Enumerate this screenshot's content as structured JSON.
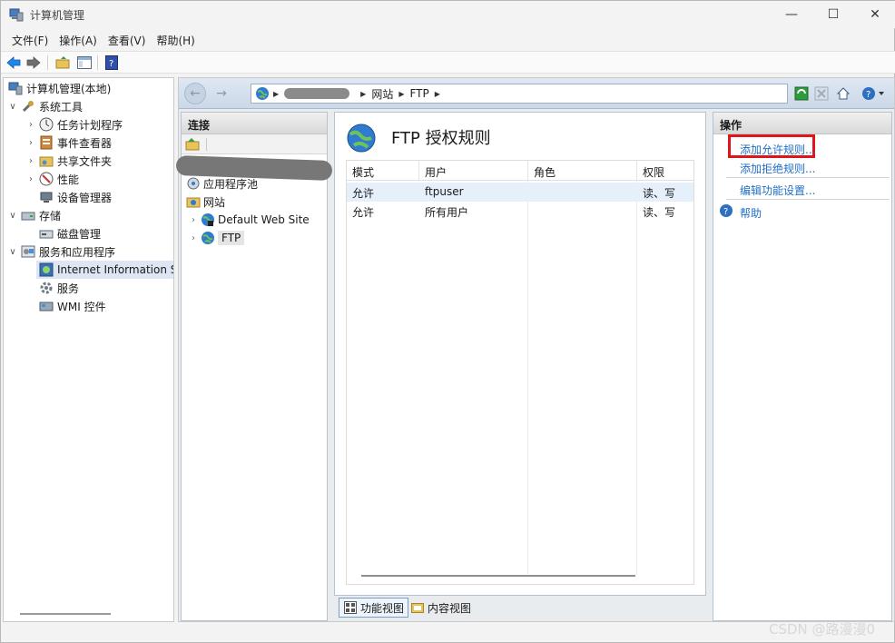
{
  "window": {
    "title": "计算机管理"
  },
  "menu": [
    "文件(F)",
    "操作(A)",
    "查看(V)",
    "帮助(H)"
  ],
  "tree": {
    "root": "计算机管理(本地)",
    "system_tools": "系统工具",
    "task_scheduler": "任务计划程序",
    "event_viewer": "事件查看器",
    "shared_folders": "共享文件夹",
    "performance": "性能",
    "device_manager": "设备管理器",
    "storage": "存储",
    "disk_management": "磁盘管理",
    "services_apps": "服务和应用程序",
    "iis": "Internet Information S",
    "services": "服务",
    "wmi": "WMI 控件"
  },
  "address": {
    "crumbs": [
      "网站",
      "FTP"
    ]
  },
  "connections": {
    "header": "连接",
    "app_pools": "应用程序池",
    "sites": "网站",
    "default_site": "Default Web Site",
    "ftp": "FTP"
  },
  "center": {
    "title": "FTP 授权规则",
    "columns": [
      "模式",
      "用户",
      "角色",
      "权限"
    ],
    "rows": [
      {
        "mode": "允许",
        "user": "ftpuser",
        "role": "",
        "perm": "读、写"
      },
      {
        "mode": "允许",
        "user": "所有用户",
        "role": "",
        "perm": "读、写"
      }
    ],
    "tabs": {
      "features": "功能视图",
      "content": "内容视图"
    }
  },
  "actions": {
    "header": "操作",
    "add_allow": "添加允许规则...",
    "add_deny": "添加拒绝规则...",
    "edit_settings": "编辑功能设置...",
    "help": "帮助"
  },
  "colors": {
    "link": "#1f6fc5",
    "highlight": "#e0141b"
  },
  "watermark": "CSDN @路漫漫0"
}
